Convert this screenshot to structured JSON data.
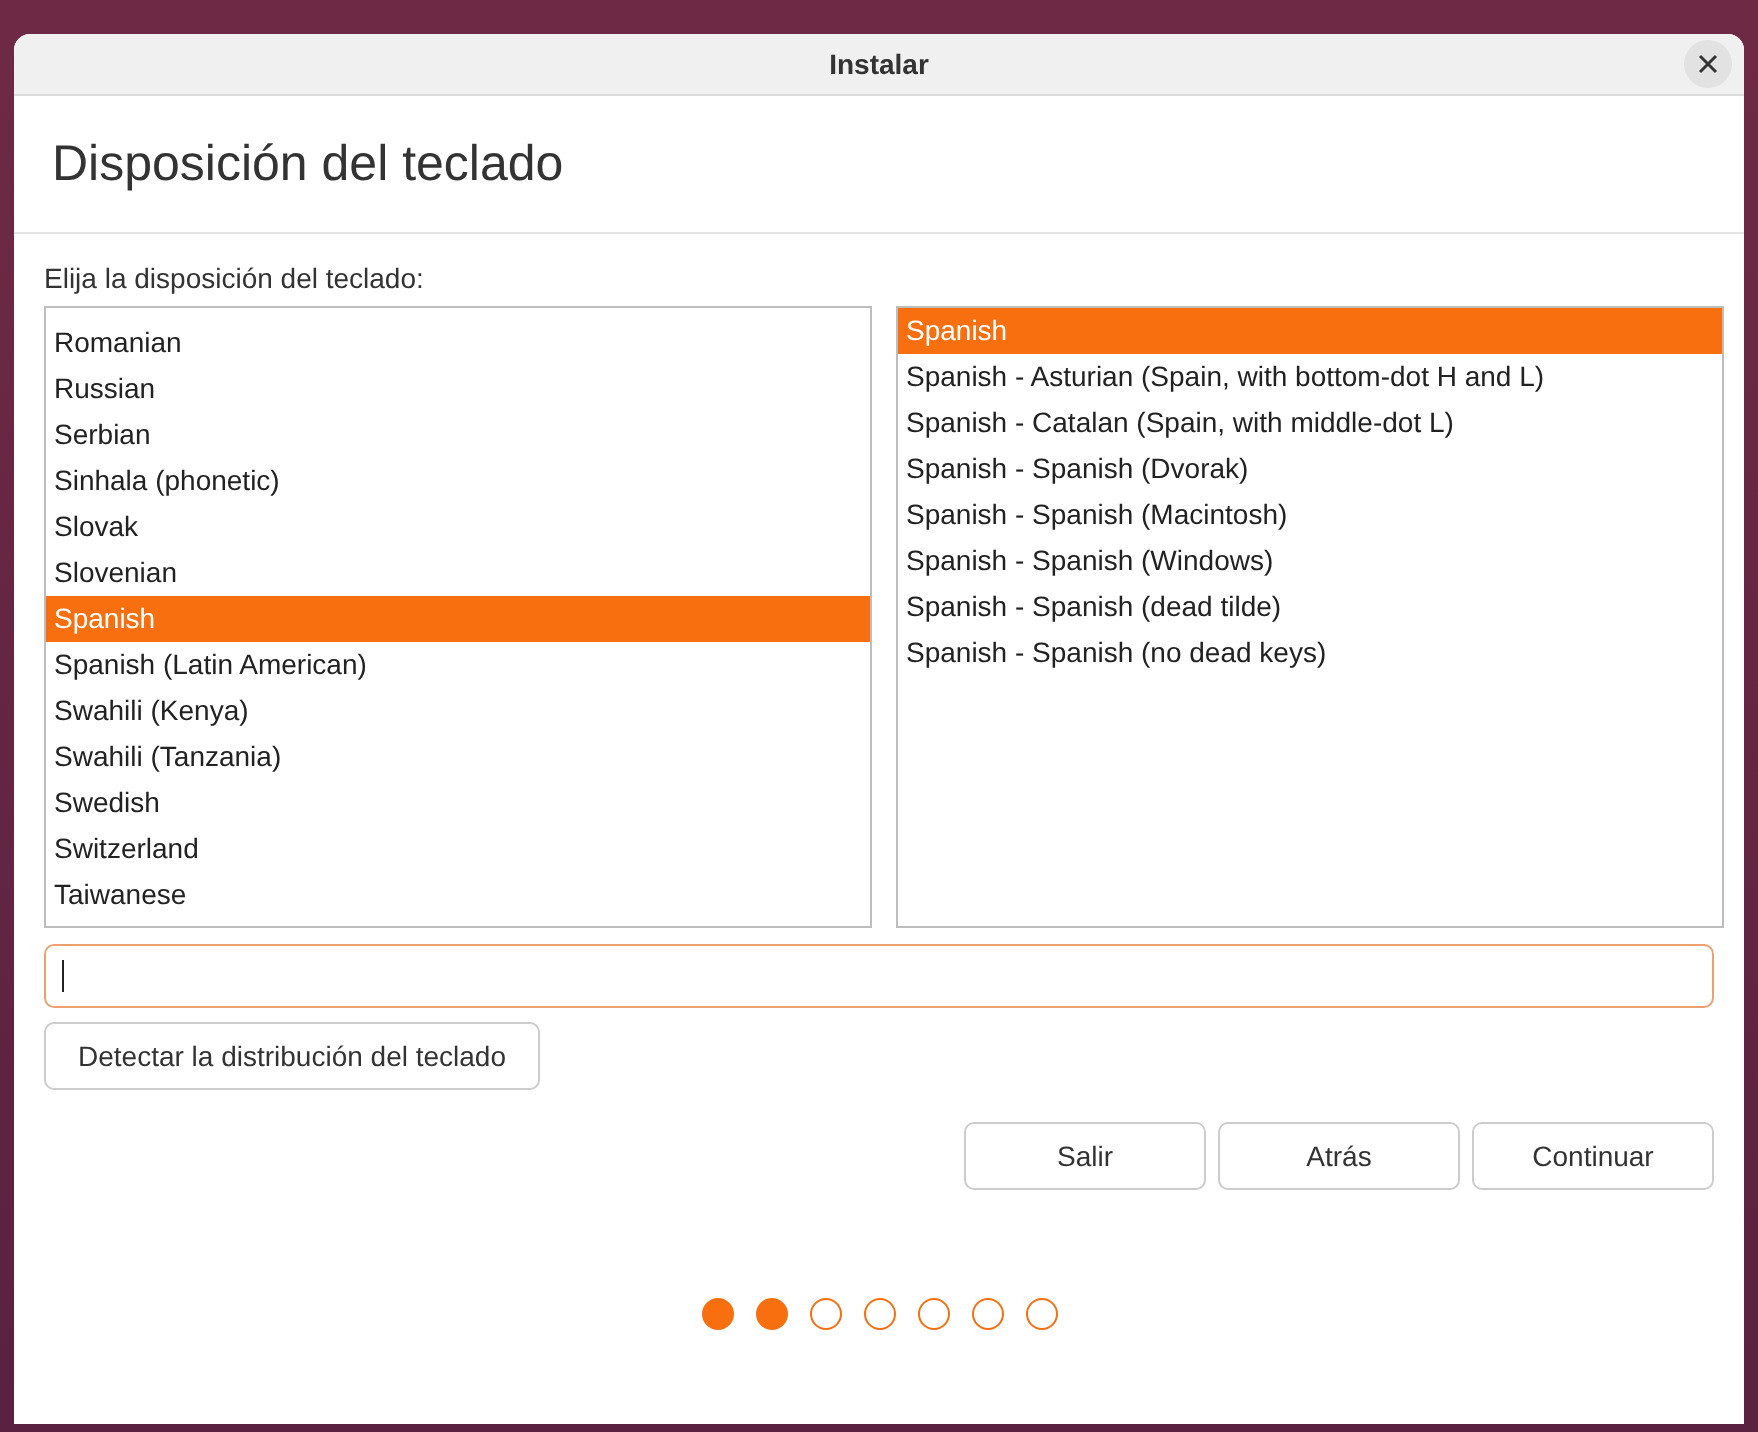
{
  "window": {
    "title": "Instalar"
  },
  "heading": "Disposición del teclado",
  "prompt": "Elija la disposición del teclado:",
  "layouts": [
    {
      "label": "Romanian",
      "selected": false
    },
    {
      "label": "Russian",
      "selected": false
    },
    {
      "label": "Serbian",
      "selected": false
    },
    {
      "label": "Sinhala (phonetic)",
      "selected": false
    },
    {
      "label": "Slovak",
      "selected": false
    },
    {
      "label": "Slovenian",
      "selected": false
    },
    {
      "label": "Spanish",
      "selected": true
    },
    {
      "label": "Spanish (Latin American)",
      "selected": false
    },
    {
      "label": "Swahili (Kenya)",
      "selected": false
    },
    {
      "label": "Swahili (Tanzania)",
      "selected": false
    },
    {
      "label": "Swedish",
      "selected": false
    },
    {
      "label": "Switzerland",
      "selected": false
    },
    {
      "label": "Taiwanese",
      "selected": false
    }
  ],
  "variants": [
    {
      "label": "Spanish",
      "selected": true
    },
    {
      "label": "Spanish - Asturian (Spain, with bottom-dot H and L)",
      "selected": false
    },
    {
      "label": "Spanish - Catalan (Spain, with middle-dot L)",
      "selected": false
    },
    {
      "label": "Spanish - Spanish (Dvorak)",
      "selected": false
    },
    {
      "label": "Spanish - Spanish (Macintosh)",
      "selected": false
    },
    {
      "label": "Spanish - Spanish (Windows)",
      "selected": false
    },
    {
      "label": "Spanish - Spanish (dead tilde)",
      "selected": false
    },
    {
      "label": "Spanish - Spanish (no dead keys)",
      "selected": false
    }
  ],
  "test_field": {
    "focused": true
  },
  "detect_button": "Detectar la distribución del teclado",
  "buttons": [
    "Salir",
    "Atrás",
    "Continuar"
  ],
  "progress_steps": [
    {
      "done": true
    },
    {
      "done": true
    },
    {
      "done": false
    },
    {
      "done": false
    },
    {
      "done": false
    },
    {
      "done": false
    },
    {
      "done": false
    }
  ]
}
